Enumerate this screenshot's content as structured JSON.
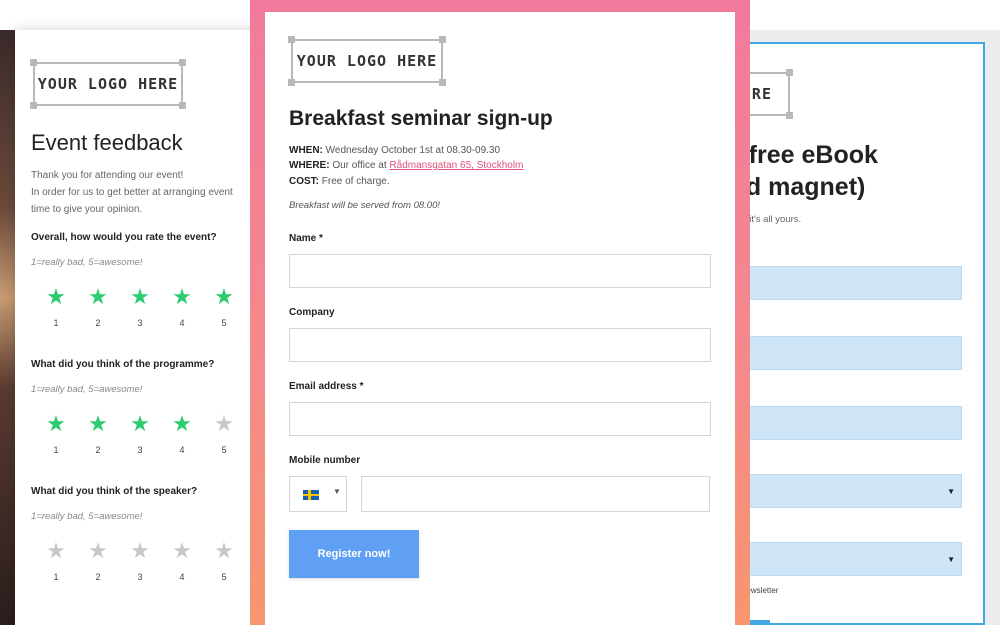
{
  "colors": {
    "accent_pink": "#f17a9d",
    "button_blue": "#5fa0f5",
    "star_green": "#2ecc71",
    "star_gray": "#c8c8c8",
    "right_border": "#43a7e6",
    "right_field": "#cfe6f8"
  },
  "left_form": {
    "logo": "YOUR LOGO HERE",
    "title": "Event feedback",
    "intro_lines": [
      "Thank you for attending our event!",
      "In order for us to get better at arranging event",
      "time to give your opinion."
    ],
    "questions": [
      {
        "label": "Overall, how would you rate the event?",
        "hint": "1=really bad, 5=awesome!",
        "rating": 5,
        "numbers": [
          "1",
          "2",
          "3",
          "4",
          "5"
        ]
      },
      {
        "label": "What did you think of the programme?",
        "hint": "1=really bad, 5=awesome!",
        "rating": 4,
        "numbers": [
          "1",
          "2",
          "3",
          "4",
          "5"
        ]
      },
      {
        "label": "What did you think of the speaker?",
        "hint": "1=really bad, 5=awesome!",
        "rating": 0,
        "numbers": [
          "1",
          "2",
          "3",
          "4",
          "5"
        ]
      }
    ]
  },
  "center_form": {
    "logo": "YOUR LOGO HERE",
    "title": "Breakfast seminar sign-up",
    "when_label": "WHEN:",
    "when_value": "Wednesday October 1st at 08.30-09.30",
    "where_label": "WHERE:",
    "where_value": "Our office at",
    "where_link": "Rådmansgatan 65, Stockholm",
    "cost_label": "COST:",
    "cost_value": "Free of charge.",
    "note": "Breakfast will be served from 08.00!",
    "fields": {
      "name_label": "Name *",
      "company_label": "Company",
      "email_label": "Email address *",
      "mobile_label": "Mobile number"
    },
    "country_flag_icon": "sweden-flag-icon",
    "submit_label": "Register now!"
  },
  "right_form": {
    "logo_visible": "ERE",
    "title_line1": "r free eBook",
    "title_line2": "ad magnet)",
    "subtitle": "nd it's all yours.",
    "newsletter": "newsletter"
  }
}
